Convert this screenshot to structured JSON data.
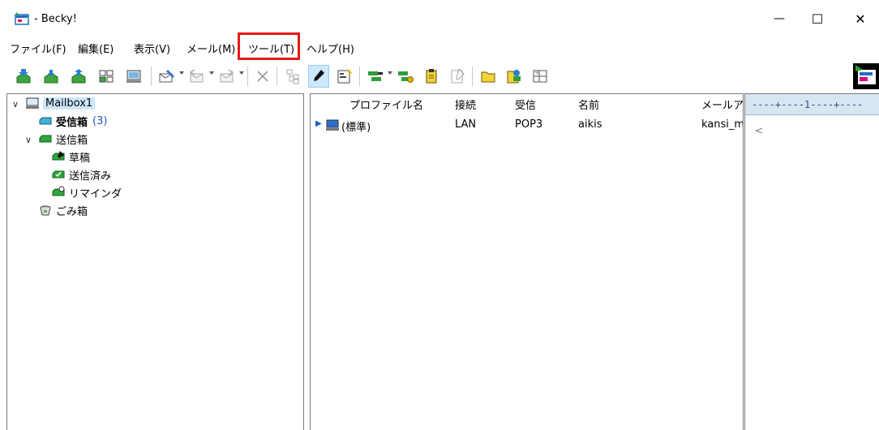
{
  "window": {
    "title": "- Becky!",
    "minimize_glyph": "—",
    "maximize_glyph": "☐",
    "close_glyph": "✕"
  },
  "menu": [
    {
      "label": "ファイル(F)"
    },
    {
      "label": "編集(E)"
    },
    {
      "label": "表示(V)"
    },
    {
      "label": "メール(M)"
    },
    {
      "label": "ツール(T)",
      "highlighted": true
    },
    {
      "label": "ヘルプ(H)"
    }
  ],
  "highlight_color": "#e61919",
  "toolbar_icons": [
    "receive-all-icon",
    "receive-icon",
    "send-receive-icon",
    "check-mail-icon",
    "mailbox-icon",
    "compose-icon",
    "reply-icon",
    "forward-icon",
    "delete-icon",
    "tree-view-icon",
    "edit-icon",
    "properties-icon",
    "filter-icon",
    "filter-manager-icon",
    "clipboard-icon",
    "note-icon",
    "folder-icon",
    "address-book-icon",
    "layout-icon"
  ],
  "tree": {
    "mailbox": "Mailbox1",
    "inbox": {
      "label": "受信箱",
      "count": "(3)"
    },
    "outbox": "送信箱",
    "drafts": "草稿",
    "sent": "送信済み",
    "reminder": "リマインダ",
    "trash": "ごみ箱"
  },
  "profile_table": {
    "headers": [
      "プロファイル名",
      "接続",
      "受信",
      "名前",
      "メールア"
    ],
    "rows": [
      {
        "profile": "(標準)",
        "connection": "LAN",
        "receive": "POP3",
        "name": "aikis",
        "mail": "kansi_m"
      }
    ]
  },
  "ruler": {
    "text": "----+----1----+----",
    "marker": "<"
  }
}
